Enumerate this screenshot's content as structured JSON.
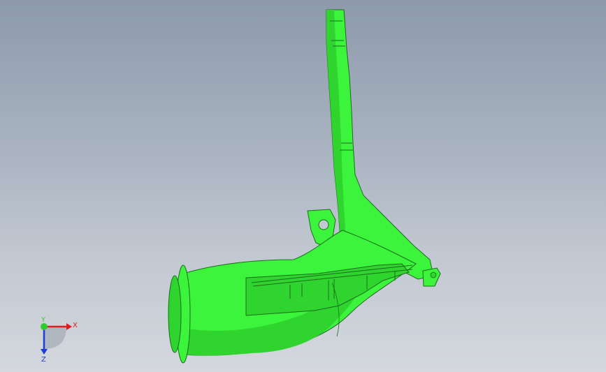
{
  "viewport": {
    "background_top": "#8d9aab",
    "background_bottom": "#d4d8de",
    "model_color": "#3cf43c",
    "model_shade": "#2fd42f",
    "model_edge": "#1c6b1c"
  },
  "triad": {
    "x_label": "X",
    "y_label": "Y",
    "z_label": "Z",
    "x_color": "#e01c1c",
    "y_color": "#2ecc2e",
    "z_color": "#1c3ce0"
  }
}
